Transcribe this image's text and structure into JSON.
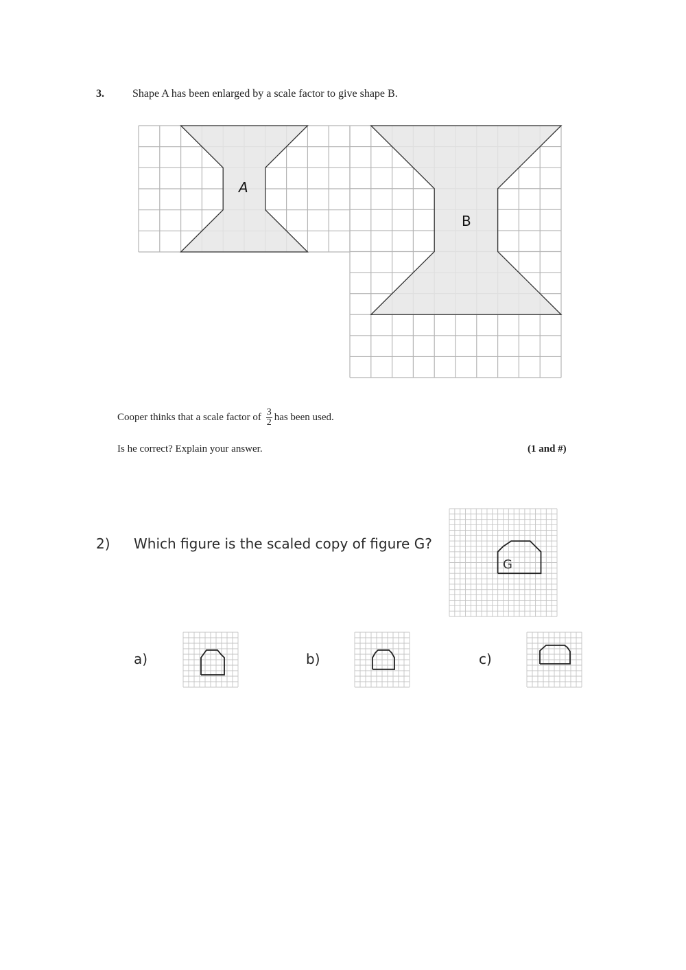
{
  "question3": {
    "number": "3.",
    "prompt": "Shape A has been enlarged by a scale factor to give shape B.",
    "shape_a_label": "A",
    "shape_b_label": "B",
    "cooper_before": "Cooper thinks that a scale factor of",
    "fraction_numerator": "3",
    "fraction_denominator": "2",
    "cooper_after": "has been used.",
    "question": "Is he correct? Explain your answer.",
    "marks": "(1 and #)"
  },
  "question2": {
    "number": "2)",
    "prompt": "Which figure is the scaled copy of figure G?",
    "figure_label": "G",
    "options": [
      {
        "label": "a)"
      },
      {
        "label": "b)"
      },
      {
        "label": "c)"
      }
    ]
  },
  "colors": {
    "grid_line": "#b5b5b5",
    "shape_fill": "#e6e6e6",
    "shape_stroke": "#333333"
  }
}
